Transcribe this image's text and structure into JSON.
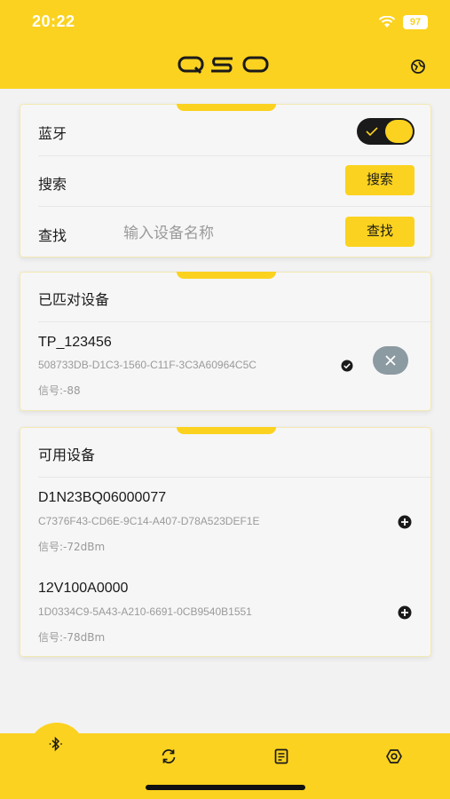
{
  "status_bar": {
    "time": "20:22",
    "battery": "97"
  },
  "header": {
    "logo": "QSO",
    "right_icon": "globe-icon"
  },
  "controls": {
    "bluetooth_label": "蓝牙",
    "bluetooth_on": true,
    "search_label": "搜索",
    "search_button": "搜索",
    "find_label": "查找",
    "find_placeholder": "输入设备名称",
    "find_button": "查找"
  },
  "paired": {
    "title": "已匹对设备",
    "devices": [
      {
        "name": "TP_123456",
        "id": "508733DB-D1C3-1560-C11F-3C3A60964C5C",
        "signal": "信号:-88"
      }
    ]
  },
  "available": {
    "title": "可用设备",
    "devices": [
      {
        "name": "D1N23BQ06000077",
        "id": "C7376F43-CD6E-9C14-A407-D78A523DEF1E",
        "signal": "信号:-72dBm"
      },
      {
        "name": "12V100A0000",
        "id": "1D0334C9-5A43-A210-6691-0CB9540B1551",
        "signal": "信号:-78dBm"
      }
    ]
  },
  "tabbar": {
    "tabs": [
      {
        "icon": "bluetooth-icon",
        "active": true
      },
      {
        "icon": "refresh-icon"
      },
      {
        "icon": "document-icon"
      },
      {
        "icon": "settings-icon"
      }
    ]
  },
  "colors": {
    "accent": "#fbd21f",
    "text": "#1a1a1a",
    "muted": "#9a9a9a",
    "remove_btn": "#8c9aa2"
  }
}
